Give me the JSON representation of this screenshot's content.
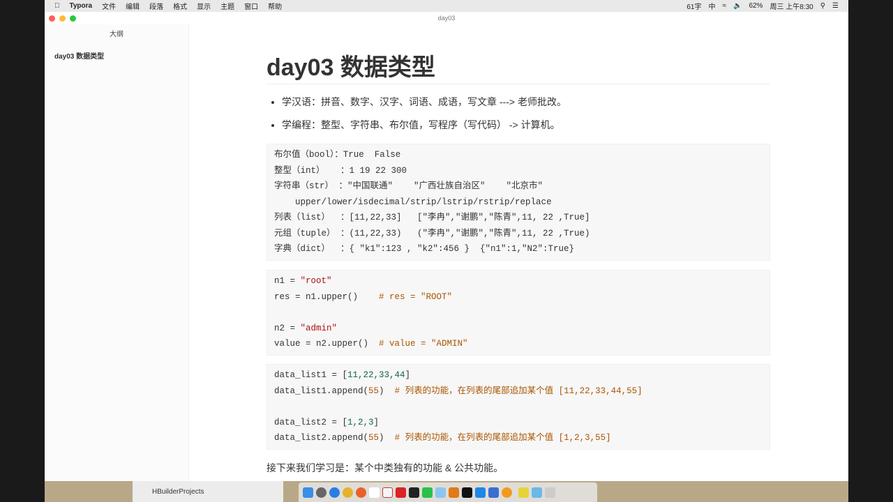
{
  "menubar": {
    "app": "Typora",
    "items": [
      "文件",
      "编辑",
      "段落",
      "格式",
      "显示",
      "主题",
      "窗口",
      "帮助"
    ],
    "word_count": "61字",
    "input_method": "中",
    "battery": "62%",
    "clock": "周三 上午8:30"
  },
  "window": {
    "title": "day03"
  },
  "sidebar": {
    "header": "大纲",
    "items": [
      "day03 数据类型"
    ]
  },
  "doc": {
    "title": "day03 数据类型",
    "bullets": [
      "学汉语：拼音、数字、汉字、词语、成语，写文章 ---> 老师批改。",
      "学编程：整型、字符串、布尔值，写程序（写代码） -> 计算机。"
    ],
    "block1": [
      "布尔值（bool）：True  False",
      "整型（int）   ：1 19 22 300",
      "字符串（str） ：\"中国联通\"    \"广西壮族自治区\"    \"北京市\"",
      "    upper/lower/isdecimal/strip/lstrip/rstrip/replace",
      "列表（list）  ：[11,22,33]   [\"李冉\",\"谢鹏\",\"陈青\",11, 22 ,True]",
      "元组（tuple） ：(11,22,33)   (\"李冉\",\"谢鹏\",\"陈青\",11, 22 ,True)",
      "字典（dict）  ：{ \"k1\":123 , \"k2\":456 }  {\"n1\":1,\"N2\":True}"
    ],
    "block2": {
      "l1a": "n1 = ",
      "l1s": "\"root\"",
      "l2a": "res = n1.upper()    ",
      "l2c": "# res = \"ROOT\"",
      "l3a": "n2 = ",
      "l3s": "\"admin\"",
      "l4a": "value = n2.upper()  ",
      "l4c": "# value = \"ADMIN\""
    },
    "block3": {
      "l1a": "data_list1 = [",
      "l1n": "11,22,33,44",
      "l1b": "]",
      "l2a": "data_list1.append(",
      "l2n": "55",
      "l2b": ")  ",
      "l2c": "# 列表的功能，在列表的尾部追加某个值 [11,22,33,44,55]",
      "l3a": "data_list2 = [",
      "l3n": "1,2,3",
      "l3b": "]",
      "l4a": "data_list2.append(",
      "l4n": "55",
      "l4b": ")  ",
      "l4c": "# 列表的功能，在列表的尾部追加某个值 [1,2,3,55]"
    },
    "footer_text": "接下来我们学习是：某个中类独有的功能 & 公共功能。"
  },
  "finder": {
    "item": "HBuilderProjects"
  }
}
